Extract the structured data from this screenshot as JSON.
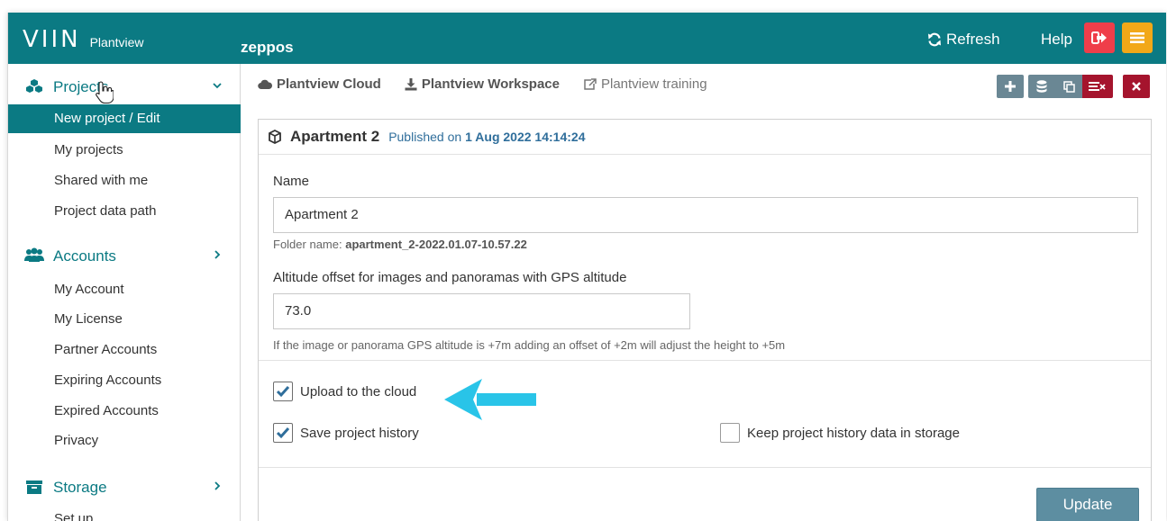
{
  "header": {
    "logo": "VIIN",
    "logo_sub": "Plantview",
    "project": "zeppos",
    "refresh": "Refresh",
    "help": "Help"
  },
  "sidebar": {
    "projects": {
      "label": "Projects",
      "items": [
        "New project / Edit",
        "My projects",
        "Shared with me",
        "Project data path"
      ]
    },
    "accounts": {
      "label": "Accounts",
      "items": [
        "My Account",
        "My License",
        "Partner Accounts",
        "Expiring Accounts",
        "Expired Accounts",
        "Privacy"
      ]
    },
    "storage": {
      "label": "Storage",
      "items": [
        "Set up"
      ]
    }
  },
  "toplinks": {
    "cloud": "Plantview Cloud",
    "workspace": "Plantview Workspace",
    "training": "Plantview training"
  },
  "card": {
    "title": "Apartment 2",
    "published_label": "Published on",
    "published_date": "1 Aug 2022 14:14:24",
    "name_label": "Name",
    "name_value": "Apartment 2",
    "folder_label": "Folder name:",
    "folder_value": "apartment_2-2022.01.07-10.57.22",
    "altitude_label": "Altitude offset for images and panoramas with GPS altitude",
    "altitude_value": "73.0",
    "altitude_help": "If the image or panorama GPS altitude is +7m adding an offset of +2m will adjust the height to +5m",
    "upload_cloud": "Upload to the cloud",
    "save_history": "Save project history",
    "keep_history": "Keep project history data in storage",
    "update": "Update"
  },
  "colors": {
    "teal": "#0b7a83",
    "logout": "#ef3e4a",
    "menu": "#f2a818",
    "arrow": "#29c4e8"
  }
}
